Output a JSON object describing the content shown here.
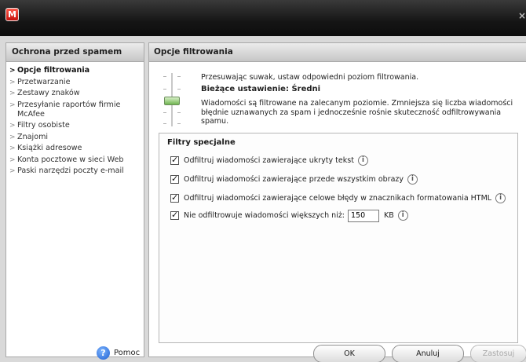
{
  "window": {
    "logo_letter": "M",
    "close_glyph": "×"
  },
  "sidebar": {
    "title": "Ochrona przed spamem",
    "items": [
      {
        "label": "Opcje filtrowania",
        "active": true
      },
      {
        "label": "Przetwarzanie"
      },
      {
        "label": "Zestawy znaków"
      },
      {
        "label": "Przesyłanie raportów firmie McAfee"
      },
      {
        "label": "Filtry osobiste"
      },
      {
        "label": "Znajomi"
      },
      {
        "label": "Książki adresowe"
      },
      {
        "label": "Konta pocztowe w sieci Web"
      },
      {
        "label": "Paski narzędzi poczty e-mail"
      }
    ],
    "help_label": "Pomoc"
  },
  "main": {
    "title": "Opcje filtrowania",
    "slider_hint": "Przesuwając suwak, ustaw odpowiedni poziom filtrowania.",
    "current_setting": "Bieżące ustawienie: Średni",
    "description": "Wiadomości są filtrowane na zalecanym poziomie. Zmniejsza się liczba wiadomości błędnie uznawanych za spam i jednocześnie rośnie skuteczność odfiltrowywania spamu.",
    "special_filters": {
      "title": "Filtry specjalne",
      "options": [
        {
          "label": "Odfiltruj wiadomości zawierające ukryty tekst",
          "checked": true
        },
        {
          "label": "Odfiltruj wiadomości zawierające przede wszystkim obrazy",
          "checked": true
        },
        {
          "label": "Odfiltruj wiadomości zawierające celowe błędy w znacznikach formatowania HTML",
          "checked": true
        },
        {
          "label": "Nie odfiltrowuje wiadomości większych niż:",
          "checked": true,
          "value": "150",
          "unit": "KB"
        }
      ]
    }
  },
  "buttons": {
    "ok": "OK",
    "cancel": "Anuluj",
    "apply": "Zastosuj"
  },
  "icons": {
    "help": "help-circle-icon",
    "info": "info-icon",
    "close": "close-icon",
    "logo": "mcafee-logo-icon"
  }
}
